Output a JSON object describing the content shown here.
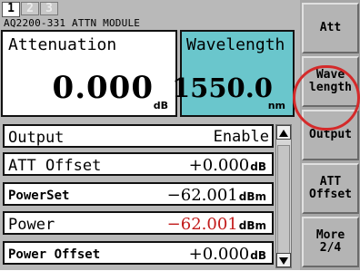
{
  "tabs": [
    "1",
    "2",
    "3"
  ],
  "module_title": "AQ2200-331 ATTN MODULE",
  "attenuation": {
    "label": "Attenuation",
    "value": "0.000",
    "unit": "dB"
  },
  "wavelength": {
    "label": "Wavelength",
    "value": "1550.0",
    "unit": "nm"
  },
  "list": [
    {
      "label": "Output",
      "value": "Enable",
      "unit": ""
    },
    {
      "label": "ATT Offset",
      "value": "+0.000",
      "unit": "dB"
    },
    {
      "label": "PowerSet",
      "value": "−62.001",
      "unit": "dBm"
    },
    {
      "label": "Power",
      "value": "−62.001",
      "unit": "dBm"
    },
    {
      "label": "Power Offset",
      "value": "+0.000",
      "unit": "dB"
    }
  ],
  "softkeys": [
    "Att",
    "Wave\nlength",
    "Output",
    "ATT\nOffset",
    "More\n2/4"
  ],
  "colors": {
    "wavelength_panel": "#6ac6cc",
    "power_value": "#c21c1c",
    "highlight_ring": "#d42a2a"
  },
  "icons": {
    "scroll_up": "triangle-up-icon",
    "scroll_down": "triangle-down-icon"
  }
}
